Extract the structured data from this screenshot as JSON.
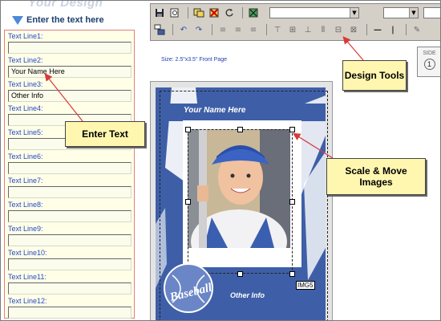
{
  "header": {
    "brand_title": "Your Design",
    "instruction": "Enter the text here"
  },
  "text_lines": [
    {
      "label": "Text Line1:",
      "value": ""
    },
    {
      "label": "Text Line2:",
      "value": "Your Name Here"
    },
    {
      "label": "Text Line3:",
      "value": "Other Info"
    },
    {
      "label": "Text Line4:",
      "value": ""
    },
    {
      "label": "Text Line5:",
      "value": ""
    },
    {
      "label": "Text Line6:",
      "value": ""
    },
    {
      "label": "Text Line7:",
      "value": ""
    },
    {
      "label": "Text Line8:",
      "value": ""
    },
    {
      "label": "Text Line9:",
      "value": ""
    },
    {
      "label": "Text Line10:",
      "value": ""
    },
    {
      "label": "Text Line11:",
      "value": ""
    },
    {
      "label": "Text Line12:",
      "value": ""
    }
  ],
  "toolbar": {
    "row1_icons": [
      "save-icon",
      "preview-icon",
      "copy-icon",
      "delete-icon",
      "undo-icon",
      "image-icon"
    ],
    "row2_icons": [
      "layers-icon",
      "undo-icon",
      "redo-icon",
      "align-left-icon",
      "align-center-icon",
      "align-right-icon",
      "align-top-icon",
      "align-middle-icon",
      "align-bottom-icon",
      "distribute-h-icon",
      "distribute-v-icon",
      "line-h-icon",
      "line-v-icon",
      "pen-icon"
    ]
  },
  "canvas": {
    "size_text": "Size: 2.5\"x3.5\"  Front Page",
    "side_label": "SIDE",
    "side_number": "1"
  },
  "card": {
    "name_text": "Your Name Here",
    "other_info": "Other Info",
    "emblem_text": "Baseball",
    "image_label": "IMG5",
    "card_color": "#3e5fa7"
  },
  "callouts": {
    "enter_text": "Enter Text",
    "design_tools": "Design Tools",
    "scale_move": "Scale & Move Images"
  },
  "colors": {
    "callout_bg": "#fff7b0",
    "arrow": "#d83a3a",
    "label_blue": "#2448c6"
  }
}
